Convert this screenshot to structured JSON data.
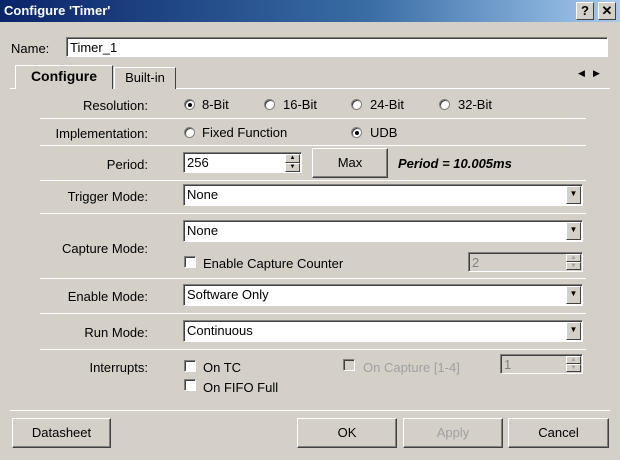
{
  "window": {
    "title": "Configure 'Timer'",
    "help_glyph": "?",
    "close_glyph": "✕"
  },
  "name": {
    "label": "Name:",
    "value": "Timer_1"
  },
  "tabs": [
    {
      "label": "Configure",
      "active": true
    },
    {
      "label": "Built-in",
      "active": false
    }
  ],
  "tab_scroll": {
    "left": "◀",
    "right": "▶"
  },
  "resolution": {
    "label": "Resolution:",
    "options": [
      "8-Bit",
      "16-Bit",
      "24-Bit",
      "32-Bit"
    ],
    "selected": "8-Bit"
  },
  "implementation": {
    "label": "Implementation:",
    "options": [
      "Fixed Function",
      "UDB"
    ],
    "selected": "UDB"
  },
  "period": {
    "label": "Period:",
    "value": "256",
    "max_button": "Max",
    "info": "Period = 10.005ms"
  },
  "trigger_mode": {
    "label": "Trigger Mode:",
    "value": "None"
  },
  "capture_mode": {
    "label": "Capture Mode:",
    "value": "None",
    "enable_counter_label": "Enable Capture Counter",
    "enable_counter_checked": false,
    "counter_value": "2"
  },
  "enable_mode": {
    "label": "Enable Mode:",
    "value": "Software Only"
  },
  "run_mode": {
    "label": "Run Mode:",
    "value": "Continuous"
  },
  "interrupts": {
    "label": "Interrupts:",
    "on_tc": "On TC",
    "on_fifo_full": "On FIFO Full",
    "on_capture": "On Capture [1-4]",
    "on_capture_value": "1"
  },
  "footer": {
    "datasheet": "Datasheet",
    "ok": "OK",
    "apply": "Apply",
    "cancel": "Cancel"
  },
  "colors": {
    "face": "#d4d0c8",
    "title_start": "#0a246a",
    "title_end": "#a6caf0"
  }
}
